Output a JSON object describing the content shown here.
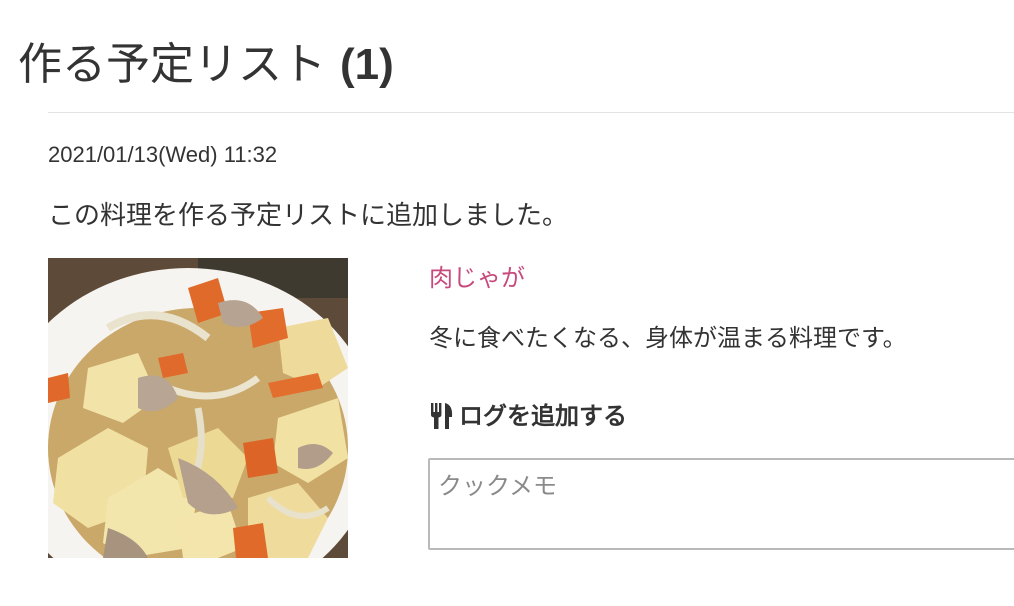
{
  "page": {
    "title": "作る予定リスト",
    "count": "(1)"
  },
  "entry": {
    "timestamp": "2021/01/13(Wed) 11:32",
    "message": "この料理を作る予定リストに追加しました。"
  },
  "recipe": {
    "name": "肉じゃが",
    "description": "冬に食べたくなる、身体が温まる料理です。",
    "photo_icon": "nikujaga-photo"
  },
  "log": {
    "heading": "ログを追加する",
    "icon": "utensils-icon",
    "memo_placeholder": "クックメモ",
    "memo_value": ""
  },
  "colors": {
    "accent_link": "#c74a7c",
    "text": "#333333",
    "divider": "#e3e3e3",
    "input_border": "#b9b9b9"
  }
}
